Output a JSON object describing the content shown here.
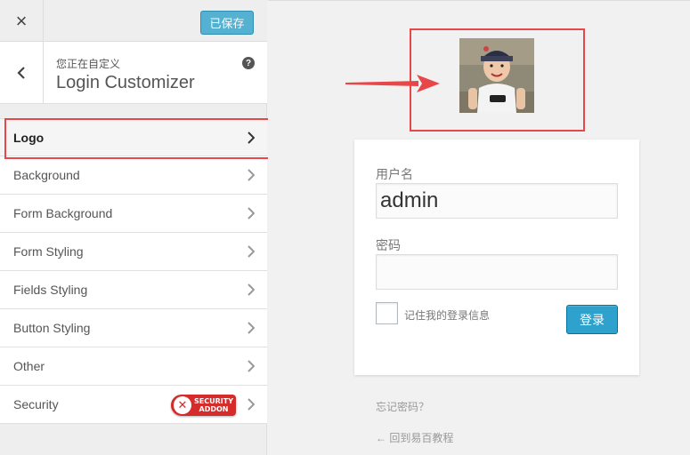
{
  "header": {
    "close_glyph": "×",
    "saved_label": "已保存"
  },
  "panel": {
    "pre_title": "您正在自定义",
    "title": "Login Customizer",
    "help_glyph": "?"
  },
  "sections": [
    {
      "label": "Logo",
      "active": true
    },
    {
      "label": "Background"
    },
    {
      "label": "Form Background"
    },
    {
      "label": "Form Styling"
    },
    {
      "label": "Fields Styling"
    },
    {
      "label": "Button Styling"
    },
    {
      "label": "Other"
    },
    {
      "label": "Security",
      "badge": {
        "icon": "x-icon",
        "line1": "SECURITY",
        "line2": "ADDON"
      }
    }
  ],
  "login": {
    "username_label": "用户名",
    "username_value": "admin",
    "password_label": "密码",
    "password_value": "",
    "remember_label": "记住我的登录信息",
    "submit_label": "登录",
    "lost_password": "忘记密码？",
    "back_link": "← 回到易百教程"
  },
  "colors": {
    "accent": "#2ea2cc",
    "highlight": "#e8474a",
    "badge": "#d52b2b"
  }
}
